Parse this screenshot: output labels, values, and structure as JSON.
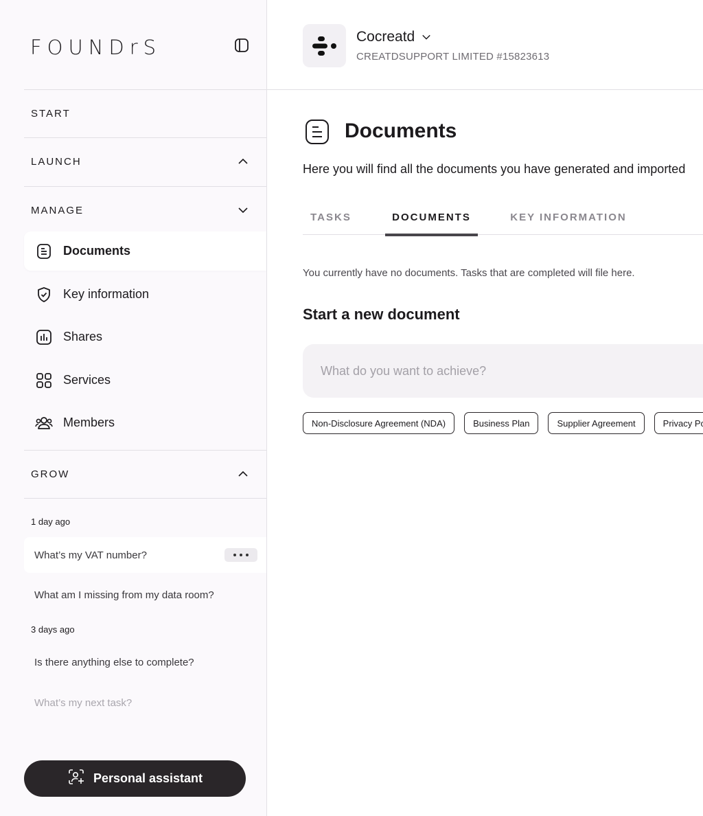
{
  "sidebar": {
    "logo": "FOUNDrS",
    "sections": {
      "start": "START",
      "launch": "LAUNCH",
      "manage": "MANAGE",
      "grow": "GROW"
    },
    "manage_items": [
      {
        "label": "Documents",
        "icon": "document-icon",
        "active": true
      },
      {
        "label": "Key information",
        "icon": "shield-check-icon"
      },
      {
        "label": "Shares",
        "icon": "bar-chart-icon"
      },
      {
        "label": "Services",
        "icon": "grid-icon"
      },
      {
        "label": "Members",
        "icon": "members-icon"
      }
    ],
    "history": {
      "group1_label": "1 day ago",
      "group1_items": [
        "What’s my VAT number?",
        "What am I missing from my data room?"
      ],
      "group2_label": "3 days ago",
      "group2_items": [
        "Is there anything else to complete?",
        "What’s my next task?"
      ]
    },
    "assistant_label": "Personal assistant"
  },
  "header": {
    "company_name": "Cocreatd",
    "company_sub": "CREATDSUPPORT LIMITED #15823613"
  },
  "main": {
    "title": "Documents",
    "description": "Here you will find all the documents you have generated and imported",
    "tabs": [
      "TASKS",
      "DOCUMENTS",
      "KEY INFORMATION"
    ],
    "active_tab": "DOCUMENTS",
    "empty_message": "You currently have no documents. Tasks that are completed will file here.",
    "new_doc_title": "Start a new document",
    "search_placeholder": "What do you want to achieve?",
    "chips": [
      "Non-Disclosure Agreement (NDA)",
      "Business Plan",
      "Supplier Agreement",
      "Privacy Policy"
    ]
  },
  "colors": {
    "sidebar_bg": "#fbf9fc",
    "accent_dark": "#2a2629",
    "tab_indicator": "#48454b"
  }
}
